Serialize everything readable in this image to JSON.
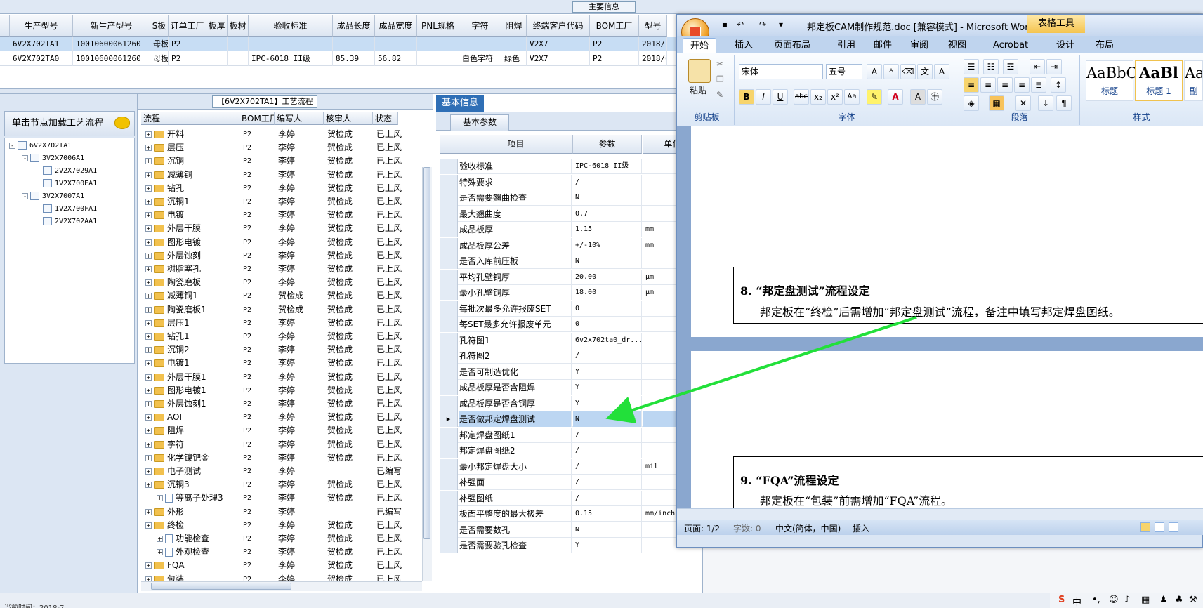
{
  "top_caption": "主要信息",
  "main_grid": {
    "headers": [
      "生产型号",
      "新生产型号",
      "S板",
      "订单工厂",
      "板厚",
      "板材",
      "验收标准",
      "成品长度",
      "成品宽度",
      "PNL规格",
      "字符",
      "阻焊",
      "终端客户代码",
      "BOM工厂",
      "型号"
    ],
    "rows": [
      [
        "6V2X702TA1",
        "10010600061260",
        "母板",
        "P2",
        "",
        "",
        "",
        "",
        "",
        "",
        "",
        "",
        "V2X7",
        "P2",
        "2018/7,"
      ],
      [
        "6V2X702TA0",
        "10010600061260",
        "母板",
        "P2",
        "",
        "",
        "IPC-6018 II级",
        "85.39",
        "56.82",
        "",
        "白色字符",
        "绿色",
        "V2X7",
        "P2",
        "2018/6,"
      ]
    ]
  },
  "left_panel": {
    "load_button": "单击节点加载工艺流程",
    "tree": [
      {
        "label": "6V2X702TA1",
        "level": 0,
        "pm": "-"
      },
      {
        "label": "3V2X7006A1",
        "level": 1,
        "pm": "-"
      },
      {
        "label": "2V2X7029A1",
        "level": 2,
        "pm": ""
      },
      {
        "label": "1V2X700EA1",
        "level": 2,
        "pm": ""
      },
      {
        "label": "3V2X7007A1",
        "level": 1,
        "pm": "-"
      },
      {
        "label": "1V2X700FA1",
        "level": 2,
        "pm": ""
      },
      {
        "label": "2V2X702AA1",
        "level": 2,
        "pm": ""
      }
    ]
  },
  "process_panel": {
    "title": "【6V2X702TA1】工艺流程",
    "headers": [
      "流程",
      "BOM工厂",
      "编写人",
      "核审人",
      "状态"
    ],
    "rows": [
      [
        "开料",
        "P2",
        "李婷",
        "贺检成",
        "已上风",
        0
      ],
      [
        "层压",
        "P2",
        "李婷",
        "贺检成",
        "已上风",
        0
      ],
      [
        "沉铜",
        "P2",
        "李婷",
        "贺检成",
        "已上风",
        0
      ],
      [
        "减薄铜",
        "P2",
        "李婷",
        "贺检成",
        "已上风",
        0
      ],
      [
        "钻孔",
        "P2",
        "李婷",
        "贺检成",
        "已上风",
        0
      ],
      [
        "沉铜1",
        "P2",
        "李婷",
        "贺检成",
        "已上风",
        0
      ],
      [
        "电镀",
        "P2",
        "李婷",
        "贺检成",
        "已上风",
        0
      ],
      [
        "外层干膜",
        "P2",
        "李婷",
        "贺检成",
        "已上风",
        0
      ],
      [
        "图形电镀",
        "P2",
        "李婷",
        "贺检成",
        "已上风",
        0
      ],
      [
        "外层蚀刻",
        "P2",
        "李婷",
        "贺检成",
        "已上风",
        0
      ],
      [
        "树脂塞孔",
        "P2",
        "李婷",
        "贺检成",
        "已上风",
        0
      ],
      [
        "陶瓷磨板",
        "P2",
        "李婷",
        "贺检成",
        "已上风",
        0
      ],
      [
        "减薄铜1",
        "P2",
        "贺检成",
        "贺检成",
        "已上风",
        0
      ],
      [
        "陶瓷磨板1",
        "P2",
        "贺检成",
        "贺检成",
        "已上风",
        0
      ],
      [
        "层压1",
        "P2",
        "李婷",
        "贺检成",
        "已上风",
        0
      ],
      [
        "钻孔1",
        "P2",
        "李婷",
        "贺检成",
        "已上风",
        0
      ],
      [
        "沉铜2",
        "P2",
        "李婷",
        "贺检成",
        "已上风",
        0
      ],
      [
        "电镀1",
        "P2",
        "李婷",
        "贺检成",
        "已上风",
        0
      ],
      [
        "外层干膜1",
        "P2",
        "李婷",
        "贺检成",
        "已上风",
        0
      ],
      [
        "图形电镀1",
        "P2",
        "李婷",
        "贺检成",
        "已上风",
        0
      ],
      [
        "外层蚀刻1",
        "P2",
        "李婷",
        "贺检成",
        "已上风",
        0
      ],
      [
        "AOI",
        "P2",
        "李婷",
        "贺检成",
        "已上风",
        0
      ],
      [
        "阻焊",
        "P2",
        "李婷",
        "贺检成",
        "已上风",
        0
      ],
      [
        "字符",
        "P2",
        "李婷",
        "贺检成",
        "已上风",
        0
      ],
      [
        "化学镍钯金",
        "P2",
        "李婷",
        "贺检成",
        "已上风",
        0
      ],
      [
        "电子测试",
        "P2",
        "李婷",
        "",
        "已编写",
        0
      ],
      [
        "沉铜3",
        "P2",
        "李婷",
        "贺检成",
        "已上风",
        0
      ],
      [
        "等离子处理3",
        "P2",
        "李婷",
        "贺检成",
        "已上风",
        1
      ],
      [
        "外形",
        "P2",
        "李婷",
        "",
        "已编写",
        0
      ],
      [
        "终检",
        "P2",
        "李婷",
        "贺检成",
        "已上风",
        0
      ],
      [
        "功能检查",
        "P2",
        "李婷",
        "贺检成",
        "已上风",
        1
      ],
      [
        "外观检查",
        "P2",
        "李婷",
        "贺检成",
        "已上风",
        1
      ],
      [
        "FQA",
        "P2",
        "李婷",
        "贺检成",
        "已上风",
        0
      ],
      [
        "包装",
        "P2",
        "李婷",
        "贺检成",
        "已上风",
        0
      ]
    ]
  },
  "basic_info": {
    "tab1": "基本信息",
    "tab2": "基本参数",
    "headers": [
      "项目",
      "参数",
      "单位"
    ],
    "rows": [
      [
        "验收标准",
        "IPC-6018 II级",
        ""
      ],
      [
        "特殊要求",
        "/",
        ""
      ],
      [
        "是否需要翘曲检查",
        "N",
        ""
      ],
      [
        "最大翘曲度",
        "0.7",
        ""
      ],
      [
        "成品板厚",
        "1.15",
        "mm"
      ],
      [
        "成品板厚公差",
        "+/-10%",
        "mm"
      ],
      [
        "是否入库前压板",
        "N",
        ""
      ],
      [
        "平均孔壁铜厚",
        "20.00",
        "μm"
      ],
      [
        "最小孔壁铜厚",
        "18.00",
        "μm"
      ],
      [
        "每批次最多允许报废SET",
        "0",
        ""
      ],
      [
        "每SET最多允许报废单元",
        "0",
        ""
      ],
      [
        "孔符图1",
        "6v2x702ta0_dr...",
        ""
      ],
      [
        "孔符图2",
        "/",
        ""
      ],
      [
        "是否可制造优化",
        "Y",
        ""
      ],
      [
        "成品板厚是否含阻焊",
        "Y",
        ""
      ],
      [
        "成品板厚是否含铜厚",
        "Y",
        ""
      ],
      [
        "是否做邦定焊盘测试",
        "N",
        ""
      ],
      [
        "邦定焊盘图纸1",
        "/",
        ""
      ],
      [
        "邦定焊盘图纸2",
        "/",
        ""
      ],
      [
        "最小邦定焊盘大小",
        "/",
        "mil"
      ],
      [
        "补强面",
        "/",
        ""
      ],
      [
        "补强图纸",
        "/",
        ""
      ],
      [
        "板面平整度的最大极差",
        "0.15",
        "mm/inch"
      ],
      [
        "是否需要数孔",
        "N",
        ""
      ],
      [
        "是否需要验孔检查",
        "Y",
        ""
      ]
    ],
    "selected_index": 16
  },
  "word": {
    "title": "邦定板CAM制作规范.doc [兼容模式] - Microsoft Word",
    "table_tools": "表格工具",
    "tabs": [
      "开始",
      "插入",
      "页面布局",
      "引用",
      "邮件",
      "审阅",
      "视图",
      "Acrobat",
      "设计",
      "布局"
    ],
    "paste_label": "粘贴",
    "font_name": "宋体",
    "font_size": "五号",
    "groups": [
      "剪贴板",
      "字体",
      "段落",
      "样式"
    ],
    "styles": [
      {
        "sample": "AaBbC",
        "name": "标题"
      },
      {
        "sample": "AaBl",
        "name": "标题 1"
      },
      {
        "sample": "Aa",
        "name": "副"
      }
    ],
    "sec8_heading": "8.  “邦定盘测试”流程设定",
    "sec8_text": "邦定板在“终检”后需增加“邦定盘测试”流程，备注中填写邦定焊盘图纸。",
    "sec9_heading": "9.  “FQA”流程设定",
    "sec9_text": "邦定板在“包装”前需增加“FQA”流程。",
    "status": {
      "page": "页面: 1/2",
      "words": "字数: 0",
      "lang": "中文(简体，中国)",
      "mode": "插入"
    },
    "arrow_color": "#22e03a"
  },
  "taskbar": {
    "ime": "中"
  },
  "bottom_status": "当前时间：2018-7 …"
}
